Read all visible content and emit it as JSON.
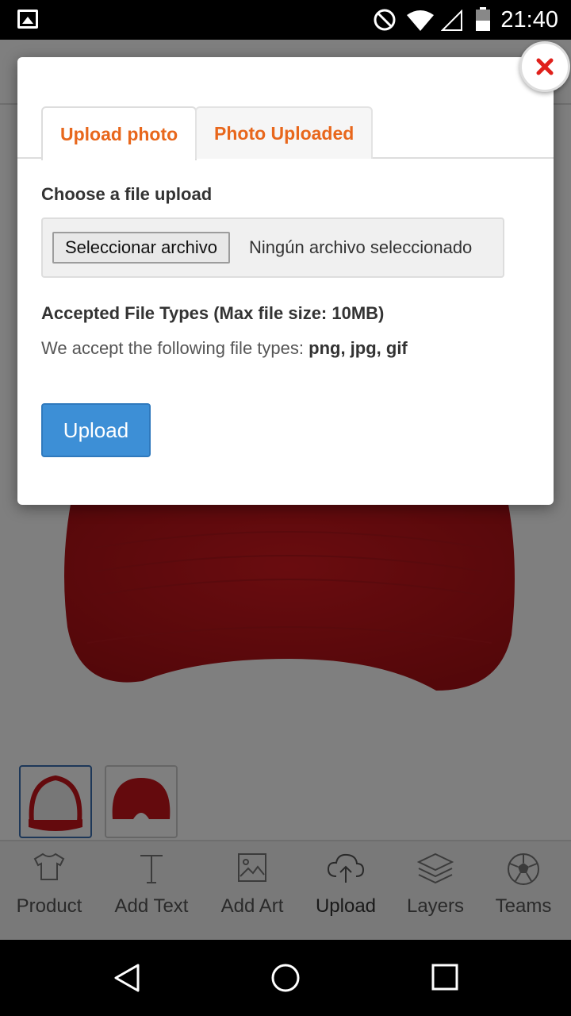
{
  "status_bar": {
    "time": "21:40",
    "icons": [
      "image-notification-icon",
      "do-not-disturb-icon",
      "wifi-icon",
      "signal-icon",
      "battery-icon"
    ]
  },
  "modal": {
    "tabs": [
      {
        "label": "Upload photo",
        "active": true
      },
      {
        "label": "Photo Uploaded",
        "active": false
      }
    ],
    "section_title": "Choose a file upload",
    "file_input": {
      "button_label": "Seleccionar archivo",
      "status": "Ningún archivo seleccionado"
    },
    "accepted_title": "Accepted File Types (Max file size: 10MB)",
    "accepted_prefix": "We accept the following file types:",
    "accepted_types": "png, jpg, gif",
    "upload_label": "Upload",
    "close_icon": "close-icon"
  },
  "toolbar": {
    "items": [
      {
        "label": "Product",
        "icon": "tshirt-icon"
      },
      {
        "label": "Add Text",
        "icon": "text-icon"
      },
      {
        "label": "Add Art",
        "icon": "image-icon"
      },
      {
        "label": "Upload",
        "icon": "cloud-upload-icon",
        "selected": true
      },
      {
        "label": "Layers",
        "icon": "layers-icon"
      },
      {
        "label": "Teams",
        "icon": "soccer-ball-icon"
      }
    ]
  },
  "thumbnails": [
    {
      "name": "cap-front",
      "active": true
    },
    {
      "name": "cap-back",
      "active": false
    }
  ],
  "colors": {
    "accent_orange": "#e8671c",
    "upload_blue": "#3d8fd6",
    "close_red": "#e0201b",
    "cap_red": "#c8151b"
  }
}
